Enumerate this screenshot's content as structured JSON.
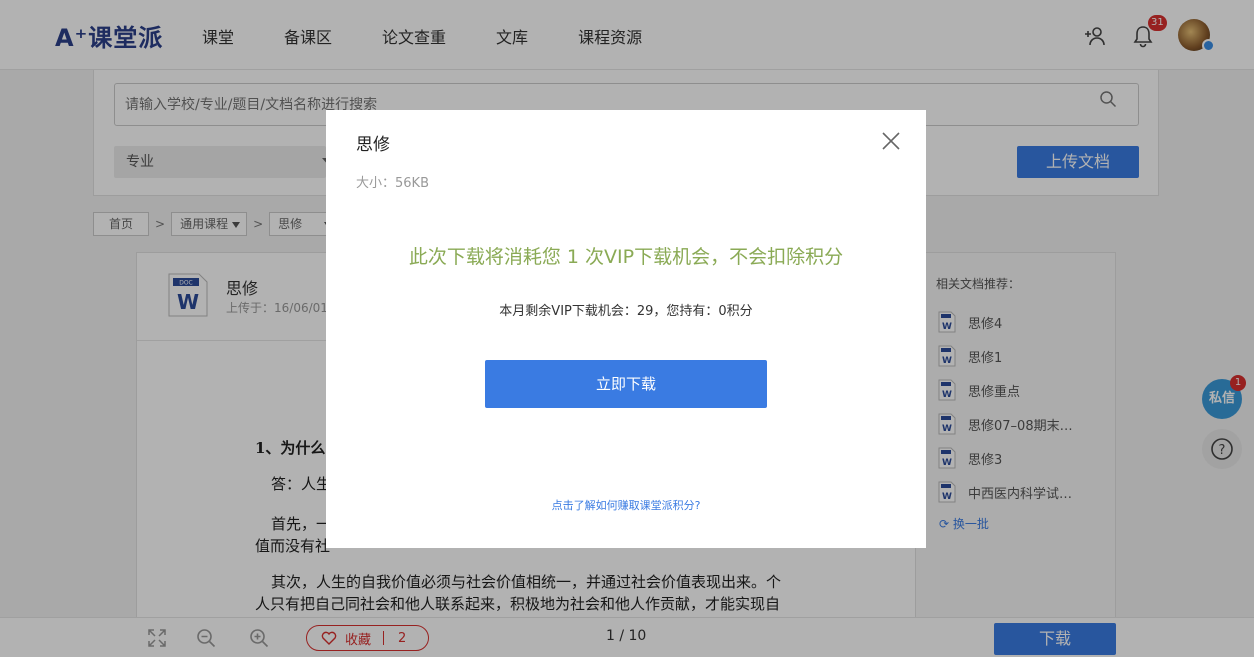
{
  "header": {
    "logo": "A⁺课堂派",
    "nav": [
      "课堂",
      "备课区",
      "论文查重",
      "文库",
      "课程资源"
    ],
    "notification_count": "31"
  },
  "search": {
    "placeholder": "请输入学校/专业/题目/文档名称进行搜索",
    "major_label": "专业",
    "upload_label": "上传文档"
  },
  "breadcrumb": {
    "home": "首页",
    "course": "通用课程",
    "subject": "思修",
    "sep": ">"
  },
  "document": {
    "title": "思修",
    "uploaded": "上传于：16/06/01",
    "icon_label": "DOC",
    "question": "1、为什么",
    "paragraphs": [
      "答：人生",
      "首先，一",
      "值而没有社",
      "其次，人生的自我价值必须与社会价值相统一，并通过社会价值表现出来。个",
      "人只有把自己同社会和他人联系起来，积极地为社会和他人作贡献，才能实现自"
    ]
  },
  "related": {
    "title": "相关文档推荐：",
    "items": [
      "思修4",
      "思修1",
      "思修重点",
      "思修07–08期末…",
      "思修3",
      "中西医内科学试…"
    ],
    "refresh": "换一批"
  },
  "floating": {
    "message_label": "私信",
    "message_count": "1",
    "help": "?"
  },
  "toolbar": {
    "favorite_label": "收藏",
    "favorite_count": "2",
    "page_indicator": "1 / 10",
    "download_label": "下载"
  },
  "modal": {
    "title": "思修",
    "size": "大小：56KB",
    "message": "此次下载将消耗您 1 次VIP下载机会，不会扣除积分",
    "remaining": "本月剩余VIP下载机会：29，您持有：0积分",
    "download_button": "立即下载",
    "help_link": "点击了解如何赚取课堂派积分?"
  },
  "colors": {
    "primary": "#3a7be2",
    "brand": "#2b3f8a",
    "accent_green": "#8aaa55",
    "badge_red": "#d8302f"
  }
}
